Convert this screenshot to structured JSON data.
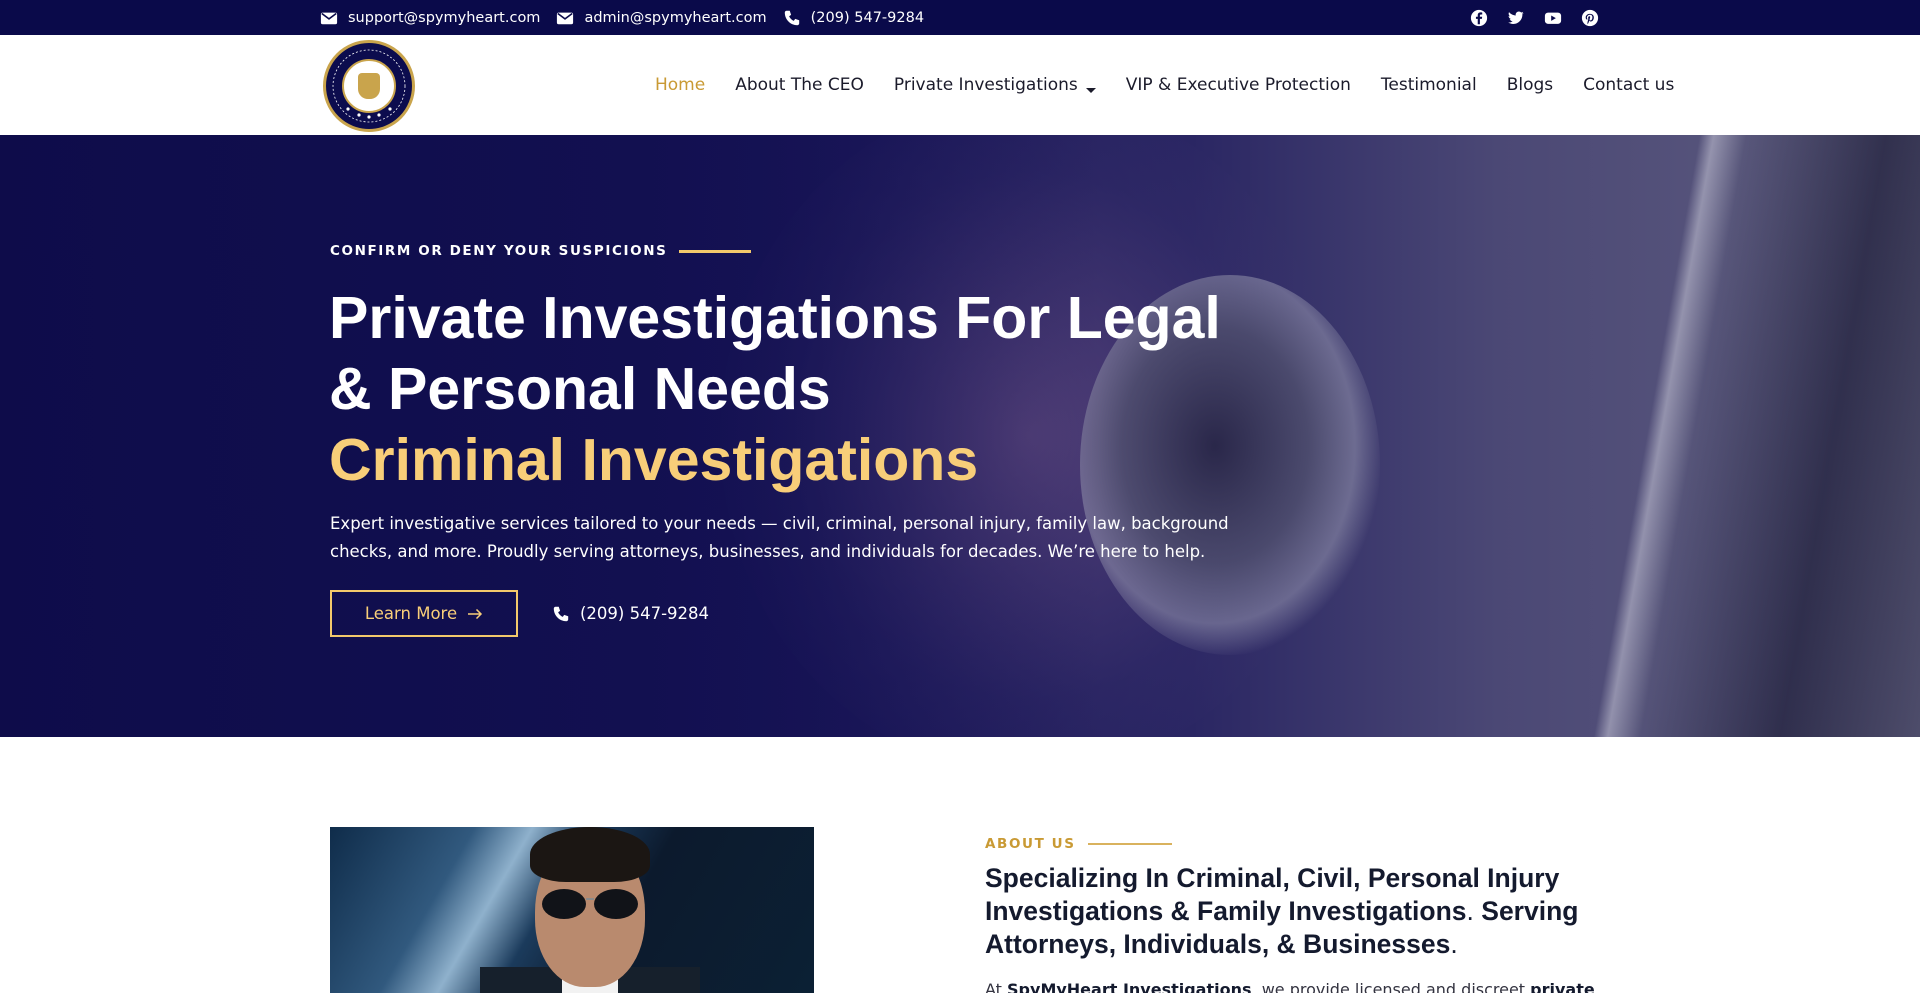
{
  "topbar": {
    "contacts": [
      {
        "icon": "envelope-icon",
        "text": "support@spymyheart.com"
      },
      {
        "icon": "envelope-icon",
        "text": "admin@spymyheart.com"
      },
      {
        "icon": "phone-icon",
        "text": "(209) 547-9284"
      }
    ],
    "socials": [
      "facebook-icon",
      "twitter-icon",
      "youtube-icon",
      "pinterest-icon"
    ]
  },
  "logo": {
    "alt_icon": "spy-my-heart-investigations-logo"
  },
  "nav": {
    "items": [
      {
        "label": "Home",
        "active": true
      },
      {
        "label": "About The CEO"
      },
      {
        "label": "Private Investigations",
        "has_dropdown": true
      },
      {
        "label": "VIP & Executive Protection"
      },
      {
        "label": "Testimonial"
      },
      {
        "label": "Blogs"
      },
      {
        "label": "Contact us"
      }
    ]
  },
  "hero": {
    "eyebrow": "CONFIRM OR DENY YOUR SUSPICIONS",
    "title_line1": "Private Investigations For Legal",
    "title_line2": "& Personal Needs",
    "rotating_title": "Criminal Investigations",
    "description": "Expert investigative services tailored to your needs — civil, criminal, personal injury, family law, background checks, and more. Proudly serving attorneys, businesses, and individuals for decades. We’re here to help.",
    "cta_label": "Learn More",
    "phone": "(209) 547-9284"
  },
  "about": {
    "eyebrow": "ABOUT US",
    "title_part1": "Specializing In Criminal, Civil, Personal Injury Investigations & Family Investigations",
    "title_sep1": ". ",
    "title_part2": "Serving Attorneys, Individuals, & Businesses",
    "title_sep2": ".",
    "body_prefix": "At ",
    "body_brand": "SpyMyHeart Investigations",
    "body_middle": ", we provide licensed and discreet ",
    "body_bold_end": "private"
  },
  "colors": {
    "topbar": "#0a0a4a",
    "gold": "#f8ce79",
    "nav_active": "#c99a34",
    "hero_overlay": "#12104f"
  }
}
